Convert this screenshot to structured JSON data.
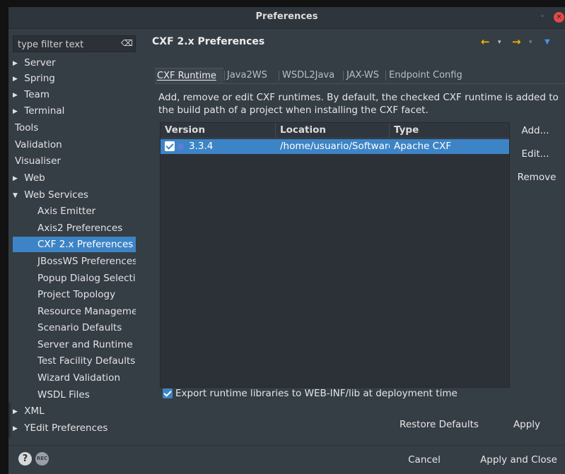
{
  "window": {
    "title": "Preferences",
    "minimize_glyph": "◦",
    "close_glyph": "✕"
  },
  "filter": {
    "placeholder": "type filter text",
    "clear_icon": "⌫"
  },
  "tree": {
    "items": [
      {
        "label": "Server",
        "expandable": true,
        "expanded": false,
        "level": 0
      },
      {
        "label": "Spring",
        "expandable": true,
        "expanded": false,
        "level": 0
      },
      {
        "label": "Team",
        "expandable": true,
        "expanded": false,
        "level": 0
      },
      {
        "label": "Terminal",
        "expandable": true,
        "expanded": false,
        "level": 0
      },
      {
        "label": "Tools",
        "expandable": false,
        "level": 0
      },
      {
        "label": "Validation",
        "expandable": false,
        "level": 0
      },
      {
        "label": "Visualiser",
        "expandable": false,
        "level": 0
      },
      {
        "label": "Web",
        "expandable": true,
        "expanded": false,
        "level": 0
      },
      {
        "label": "Web Services",
        "expandable": true,
        "expanded": true,
        "level": 0
      },
      {
        "label": "Axis Emitter",
        "level": 1
      },
      {
        "label": "Axis2 Preferences",
        "level": 1
      },
      {
        "label": "CXF 2.x Preferences",
        "level": 1,
        "selected": true
      },
      {
        "label": "JBossWS Preferences",
        "level": 1
      },
      {
        "label": "Popup Dialog Selection",
        "level": 1
      },
      {
        "label": "Project Topology",
        "level": 1
      },
      {
        "label": "Resource Management",
        "level": 1
      },
      {
        "label": "Scenario Defaults",
        "level": 1
      },
      {
        "label": "Server and Runtime",
        "level": 1
      },
      {
        "label": "Test Facility Defaults",
        "level": 1
      },
      {
        "label": "Wizard Validation",
        "level": 1
      },
      {
        "label": "WSDL Files",
        "level": 1
      },
      {
        "label": "XML",
        "expandable": true,
        "expanded": false,
        "level": 0
      },
      {
        "label": "YEdit Preferences",
        "expandable": true,
        "expanded": false,
        "level": 0
      }
    ]
  },
  "page": {
    "title": "CXF 2.x Preferences"
  },
  "nav": {
    "back_icon": "🡠",
    "forward_icon": "🡢",
    "dropdown_glyph": "▾",
    "menu_glyph": "▼"
  },
  "tabs": [
    {
      "label": "CXF Runtime",
      "mnemonic": "C",
      "active": true
    },
    {
      "label": "Java2WS",
      "mnemonic": "J",
      "active": false
    },
    {
      "label": "WSDL2Java",
      "mnemonic": "W",
      "active": false
    },
    {
      "label": "JAX-WS",
      "mnemonic": "X",
      "active": false
    },
    {
      "label": "Endpoint Config",
      "mnemonic": "n",
      "active": false
    }
  ],
  "description": "Add, remove or edit CXF runtimes. By default, the checked CXF runtime is added to the build path of a project when installing the CXF facet.",
  "table": {
    "columns": [
      "Version",
      "Location",
      "Type"
    ],
    "rows": [
      {
        "checked": true,
        "version": "3.3.4",
        "location": "/home/usuario/Software",
        "type": "Apache CXF"
      }
    ]
  },
  "side_buttons": {
    "add": "Add...",
    "edit": "Edit...",
    "remove": "Remove"
  },
  "export_option": {
    "checked": true,
    "label": "Export runtime libraries to WEB-INF/lib at deployment time"
  },
  "page_buttons": {
    "restore_defaults": "Restore Defaults",
    "apply": "Apply"
  },
  "dialog_buttons": {
    "cancel": "Cancel",
    "apply_and_close": "Apply and Close"
  },
  "bottom_icons": {
    "help": "?",
    "record": "REC"
  },
  "colors": {
    "selection": "#3d84c6",
    "accent_arrow": "#f0b400",
    "close_button": "#e34a4a"
  }
}
